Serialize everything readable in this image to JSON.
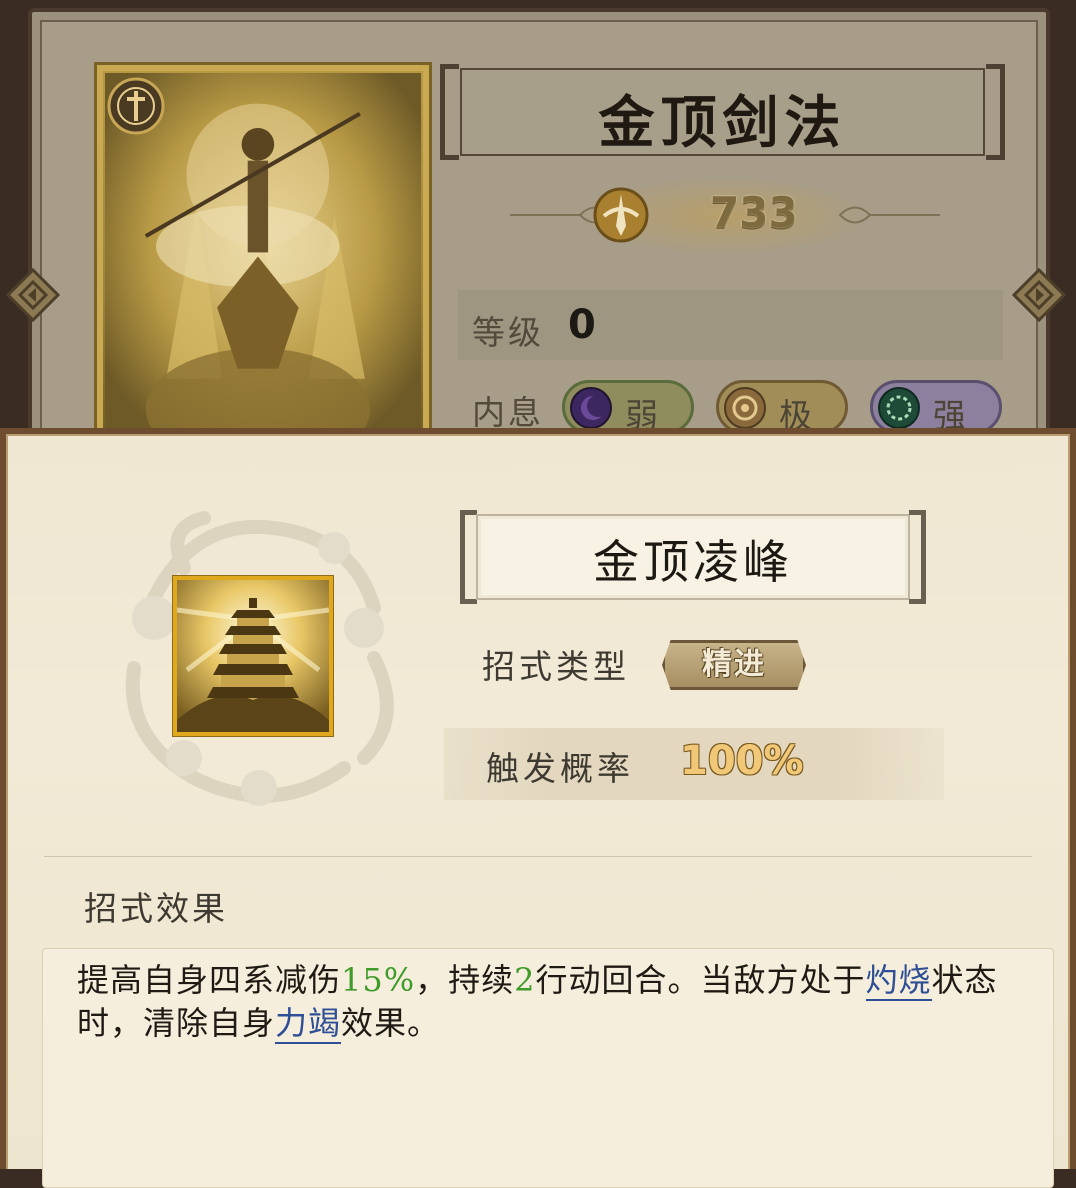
{
  "background_card": {
    "skill_name": "金顶剑法",
    "power_value": "733",
    "level_label": "等级",
    "level_value": "0",
    "neixi_label": "内息",
    "neixi_pills": [
      {
        "label": "弱",
        "orb_color": "#4b2f6e",
        "pill_color": "#8d8a5a"
      },
      {
        "label": "极",
        "orb_color": "#8a6a3c",
        "pill_color": "#9a8b58"
      },
      {
        "label": "强",
        "orb_color": "#1f4e3a",
        "pill_color": "#8b7d9a"
      }
    ]
  },
  "popup": {
    "move_name": "金顶凌峰",
    "type_label": "招式类型",
    "type_value": "精进",
    "rate_label": "触发概率",
    "rate_value": "100%",
    "effect_title": "招式效果",
    "effect": {
      "p1": "提高自身四系减伤",
      "v1": "15%",
      "p2": "，持续",
      "v2": "2",
      "p3": "行动回合。当敌方处于",
      "link1": "灼烧",
      "p4": "状态时，清除自身",
      "link2": "力竭",
      "p5": "效果。"
    }
  },
  "colors": {
    "accent_gold": "#e0a81c",
    "highlight_green": "#3f9b2a",
    "link_blue": "#2e4e95"
  }
}
